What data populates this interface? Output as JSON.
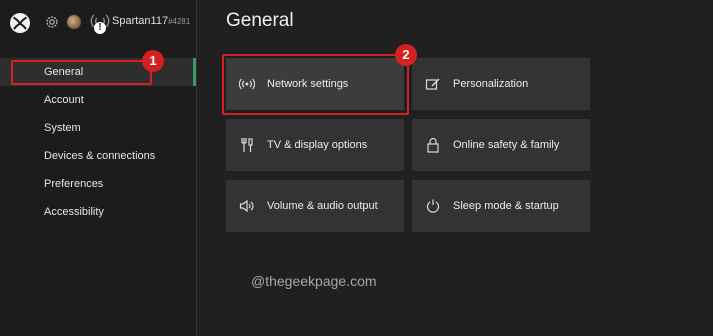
{
  "header": {
    "gamertag": "Spartan117",
    "gamertag_suffix": "#4281",
    "alert_glyph": "!"
  },
  "sidebar": {
    "items": [
      {
        "label": "General",
        "active": true
      },
      {
        "label": "Account"
      },
      {
        "label": "System"
      },
      {
        "label": "Devices & connections"
      },
      {
        "label": "Preferences"
      },
      {
        "label": "Accessibility"
      }
    ]
  },
  "main": {
    "title": "General",
    "tiles": [
      {
        "label": "Network settings",
        "icon": "network-icon"
      },
      {
        "label": "Personalization",
        "icon": "personalization-icon"
      },
      {
        "label": "TV & display options",
        "icon": "tv-display-icon"
      },
      {
        "label": "Online safety & family",
        "icon": "lock-icon"
      },
      {
        "label": "Volume & audio output",
        "icon": "speaker-icon"
      },
      {
        "label": "Sleep mode & startup",
        "icon": "power-icon"
      }
    ]
  },
  "annotations": {
    "marker_1": "1",
    "marker_2": "2"
  },
  "watermark": "@thegeekpage.com",
  "colors": {
    "accent": "#3a9b6a",
    "annotation_red": "#d42020",
    "background": "#202020",
    "tile": "#333333"
  }
}
